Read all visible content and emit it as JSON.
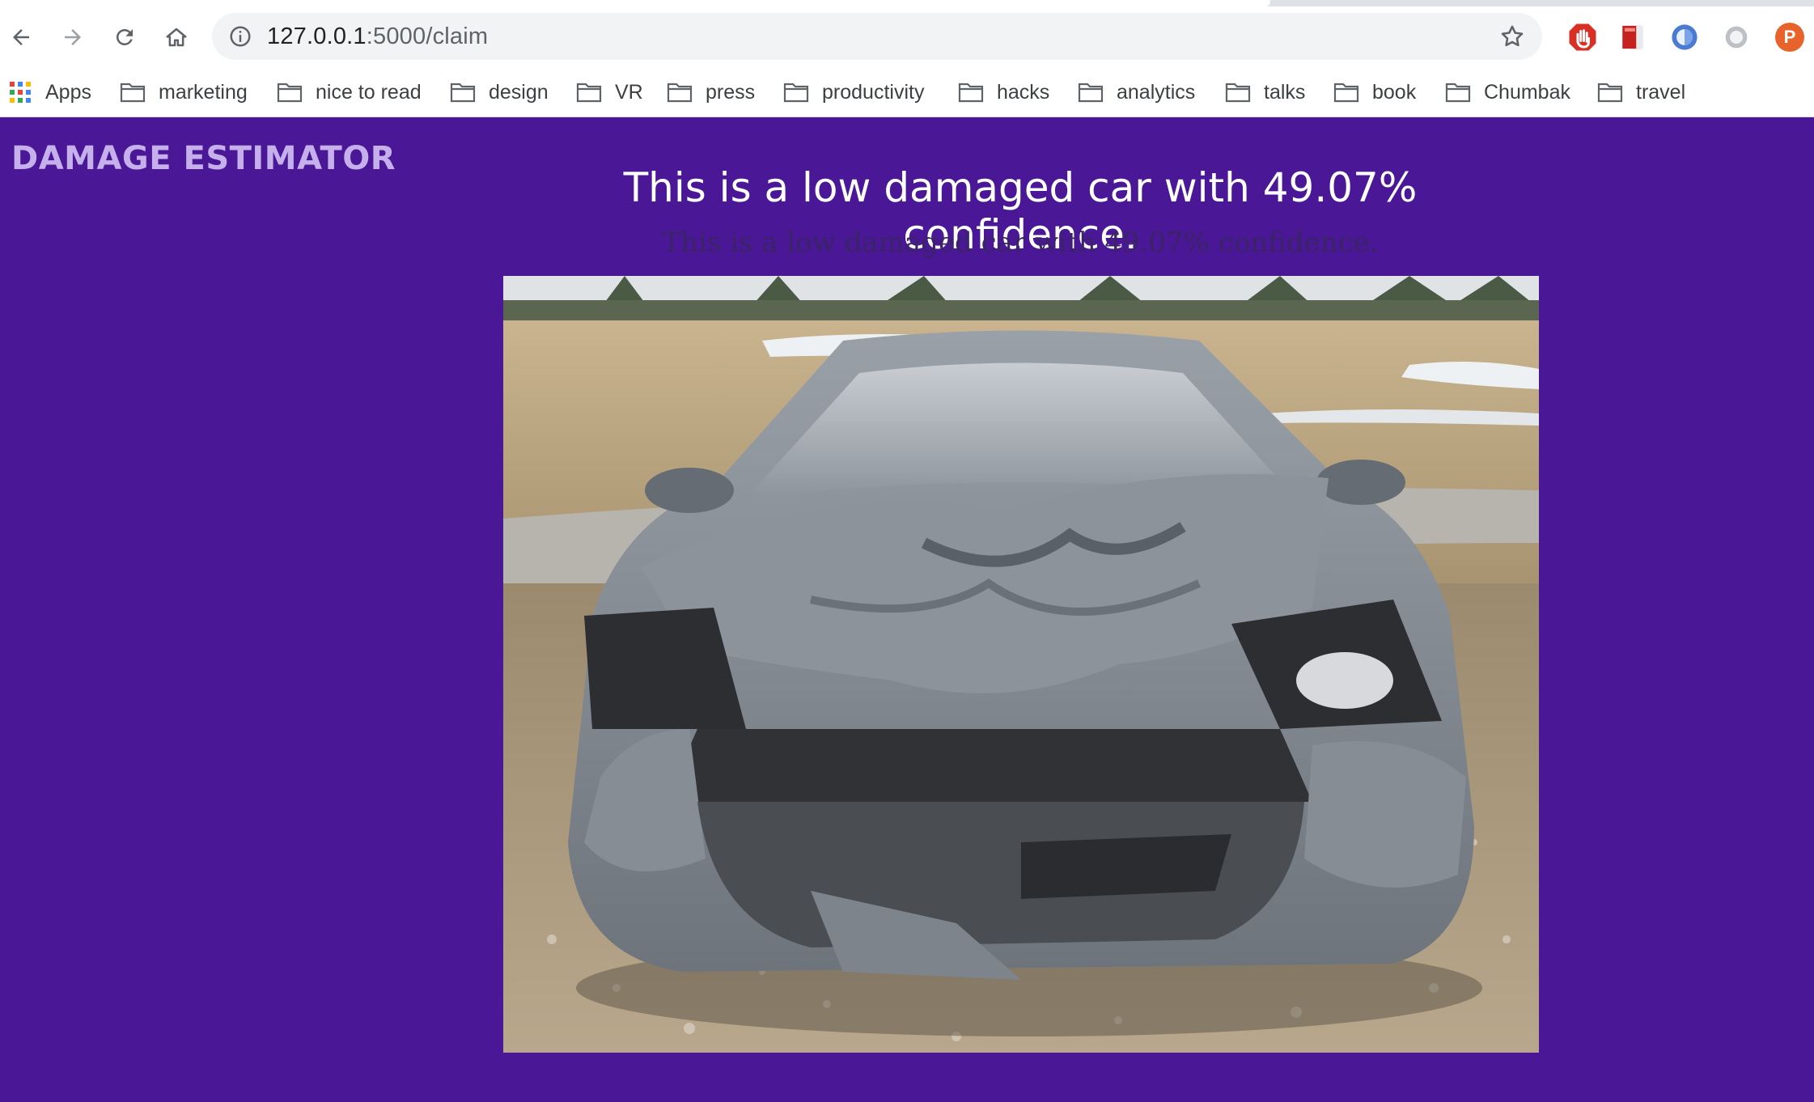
{
  "browser": {
    "url_host": "127.0.0.1",
    "url_path": ":5000/claim",
    "bookmarks": [
      "Apps",
      "marketing",
      "nice to read",
      "design",
      "VR",
      "press",
      "productivity",
      "hacks",
      "analytics",
      "talks",
      "book",
      "Chumbak",
      "travel"
    ],
    "extension_letter": "P"
  },
  "page": {
    "brand": "DAMAGE ESTIMATOR",
    "headline": "This is a low damaged car with 49.07% confidence.",
    "subline": "This is a low damaged car with 49.07% confidence.",
    "photo_subject": "front-damaged-car"
  },
  "colors": {
    "page_background": "#4a1796",
    "brand_text": "#c6b0ec",
    "headline_text": "#ffffff"
  }
}
